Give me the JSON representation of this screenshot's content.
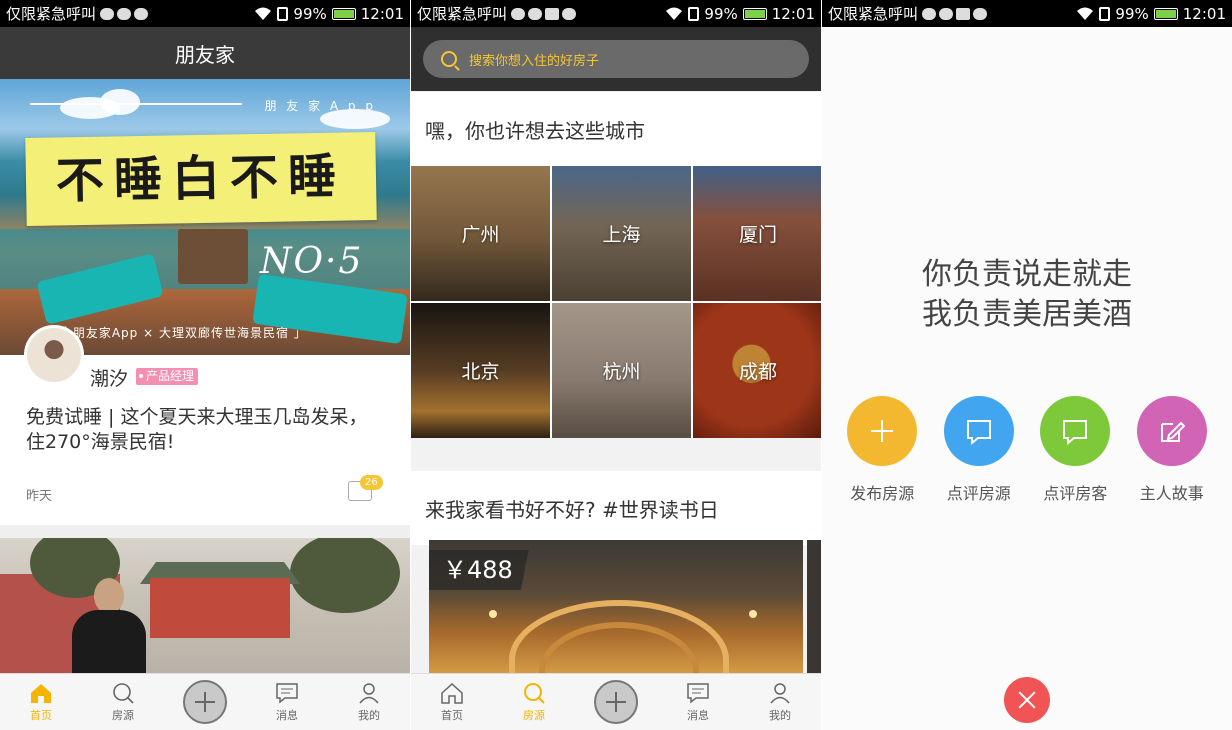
{
  "status_bars": [
    {
      "carrier": "仅限紧急呼叫",
      "battery": "99%",
      "time": "12:01"
    },
    {
      "carrier": "仅限紧急呼叫",
      "battery": "99%",
      "time": "12:01"
    },
    {
      "carrier": "仅限紧急呼叫",
      "battery": "99%",
      "time": "12:01"
    }
  ],
  "screen1": {
    "header_title": "朋友家",
    "banner": {
      "app_tag": "朋 友 家 A p p",
      "headline": "不睡白不睡",
      "issue": "NO·5",
      "subline": "「 朋友家App × 大理双廊传世海景民宿 」"
    },
    "post": {
      "author": "潮汐",
      "role": "产品经理",
      "title": "免费试睡 | 这个夏天来大理玉几岛发呆，住270°海景民宿!",
      "time": "昨天",
      "comment_count": "26"
    }
  },
  "screen2": {
    "search_placeholder": "搜索你想入住的好房子",
    "cities_title": "嘿，你也许想去这些城市",
    "cities": [
      {
        "name": "广州",
        "color": "#8a6a46"
      },
      {
        "name": "上海",
        "color": "#7d6f5c"
      },
      {
        "name": "厦门",
        "color": "#9a5a45"
      },
      {
        "name": "北京",
        "color": "#6a4a2c"
      },
      {
        "name": "杭州",
        "color": "#a8978a"
      },
      {
        "name": "成都",
        "color": "#a63820"
      }
    ],
    "feature_title": "来我家看书好不好? #世界读书日",
    "feature_price": "￥488"
  },
  "tabbar": {
    "tabs": [
      {
        "key": "home",
        "label": "首页"
      },
      {
        "key": "listings",
        "label": "房源"
      },
      {
        "key": "add",
        "label": ""
      },
      {
        "key": "messages",
        "label": "消息"
      },
      {
        "key": "me",
        "label": "我的"
      }
    ],
    "active_color": "#f5b400"
  },
  "screen3": {
    "slogan_line1": "你负责说走就走",
    "slogan_line2": "我负责美居美酒",
    "actions": [
      {
        "label": "发布房源",
        "color": "#f3b82f",
        "icon": "plus-icon"
      },
      {
        "label": "点评房源",
        "color": "#42a5ef",
        "icon": "chat-bubble-icon"
      },
      {
        "label": "点评房客",
        "color": "#7ec93a",
        "icon": "chat-bubble-icon"
      },
      {
        "label": "主人故事",
        "color": "#d164b5",
        "icon": "edit-icon"
      }
    ],
    "close_color": "#f05454"
  }
}
